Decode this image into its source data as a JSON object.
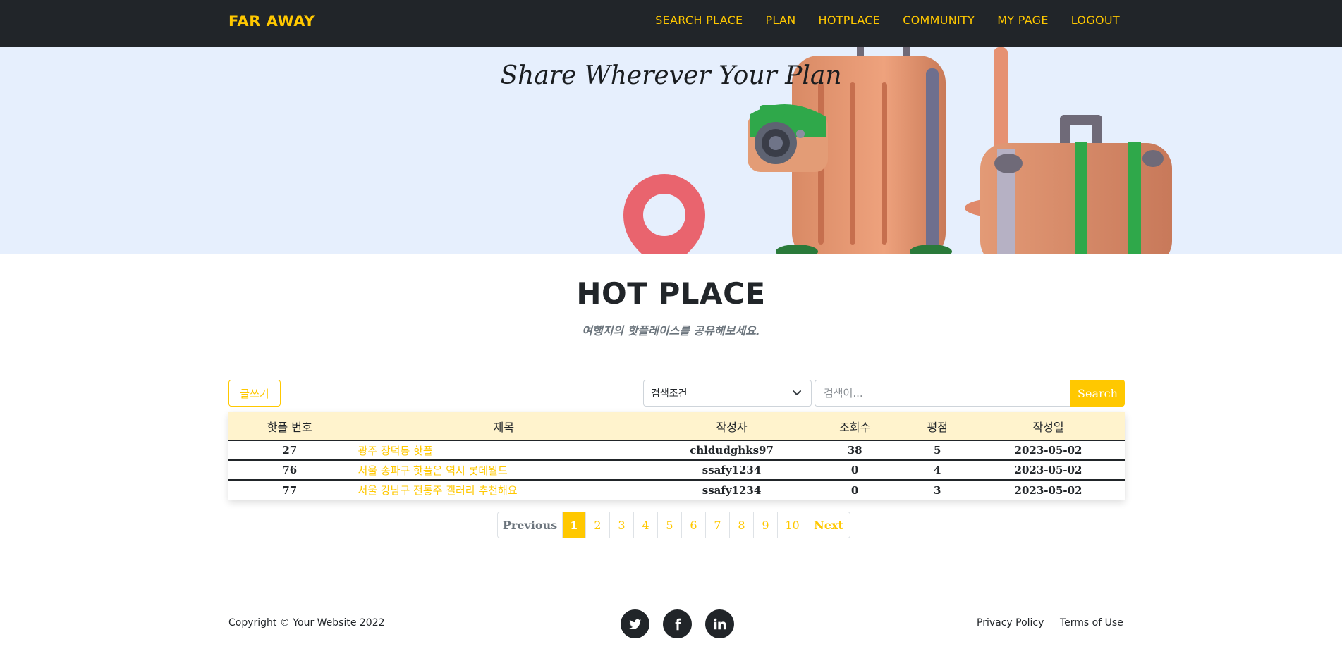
{
  "navbar": {
    "brand": "FAR AWAY",
    "links": [
      "SEARCH PLACE",
      "PLAN",
      "HOTPLACE",
      "COMMUNITY",
      "MY PAGE",
      "LOGOUT"
    ]
  },
  "hero": {
    "title": "Share Wherever Your Plan"
  },
  "section": {
    "heading": "HOT PLACE",
    "subheading": "여행지의 핫플레이스를 공유해보세요."
  },
  "toolbar": {
    "write_label": "글쓰기",
    "search_condition": "검색조건",
    "search_placeholder": "검색어...",
    "search_label": "Search"
  },
  "table": {
    "headers": [
      "핫플 번호",
      "제목",
      "작성자",
      "조회수",
      "평점",
      "작성일"
    ],
    "rows": [
      {
        "no": "27",
        "title": "광주 장덕동 핫플",
        "author": "chldudghks97",
        "views": "38",
        "rating": "5",
        "date": "2023-05-02"
      },
      {
        "no": "76",
        "title": "서울 송파구 핫플은 역시 롯데월드",
        "author": "ssafy1234",
        "views": "0",
        "rating": "4",
        "date": "2023-05-02"
      },
      {
        "no": "77",
        "title": "서울 강남구 전통주 갤러리 추천해요",
        "author": "ssafy1234",
        "views": "0",
        "rating": "3",
        "date": "2023-05-02"
      }
    ]
  },
  "pagination": {
    "prev": "Previous",
    "pages": [
      "1",
      "2",
      "3",
      "4",
      "5",
      "6",
      "7",
      "8",
      "9",
      "10"
    ],
    "next": "Next",
    "active_page": "1"
  },
  "footer": {
    "copyright": "Copyright © Your Website 2022",
    "social_icons": [
      "twitter-icon",
      "facebook-icon",
      "linkedin-icon"
    ],
    "privacy": "Privacy Policy",
    "terms": "Terms of Use"
  },
  "colors": {
    "accent": "#ffc800",
    "dark": "#212529",
    "hero_bg": "#e6effd",
    "table_header_bg": "#fff3cd"
  }
}
